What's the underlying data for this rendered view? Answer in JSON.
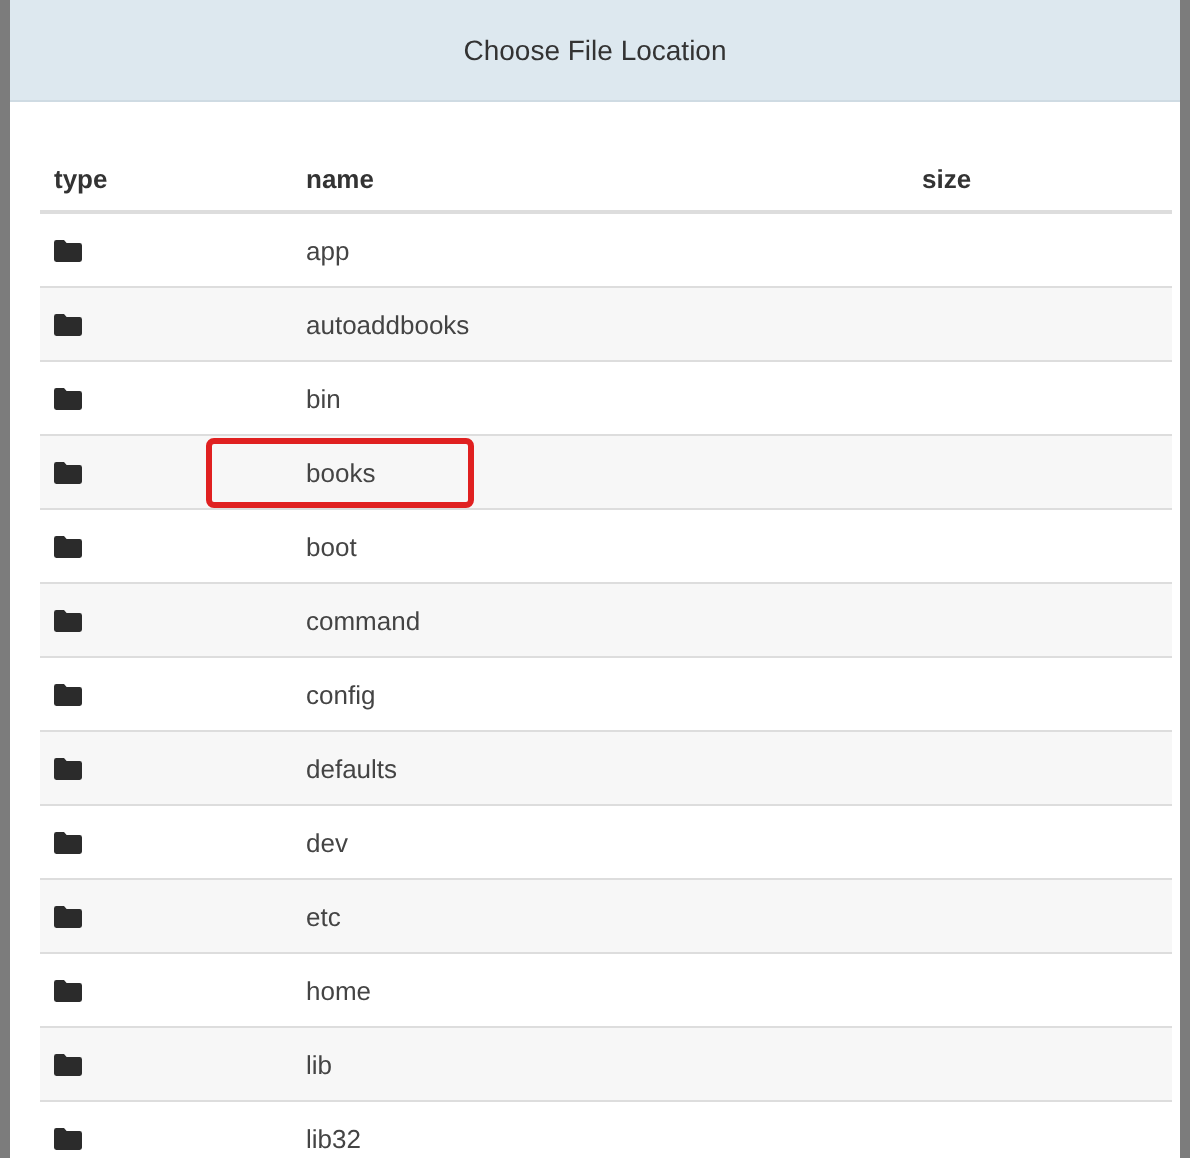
{
  "dialog": {
    "title": "Choose File Location"
  },
  "table": {
    "columns": [
      "type",
      "name",
      "size"
    ],
    "rows": [
      {
        "kind": "folder",
        "name": "app",
        "marked": false
      },
      {
        "kind": "folder",
        "name": "autoaddbooks",
        "marked": false
      },
      {
        "kind": "folder",
        "name": "bin",
        "marked": false
      },
      {
        "kind": "folder",
        "name": "books",
        "marked": true
      },
      {
        "kind": "folder",
        "name": "boot",
        "marked": false
      },
      {
        "kind": "folder",
        "name": "command",
        "marked": false
      },
      {
        "kind": "folder",
        "name": "config",
        "marked": false
      },
      {
        "kind": "folder",
        "name": "defaults",
        "marked": false
      },
      {
        "kind": "folder",
        "name": "dev",
        "marked": false
      },
      {
        "kind": "folder",
        "name": "etc",
        "marked": false
      },
      {
        "kind": "folder",
        "name": "home",
        "marked": false
      },
      {
        "kind": "folder",
        "name": "lib",
        "marked": false
      },
      {
        "kind": "folder",
        "name": "lib32",
        "marked": false
      }
    ]
  }
}
